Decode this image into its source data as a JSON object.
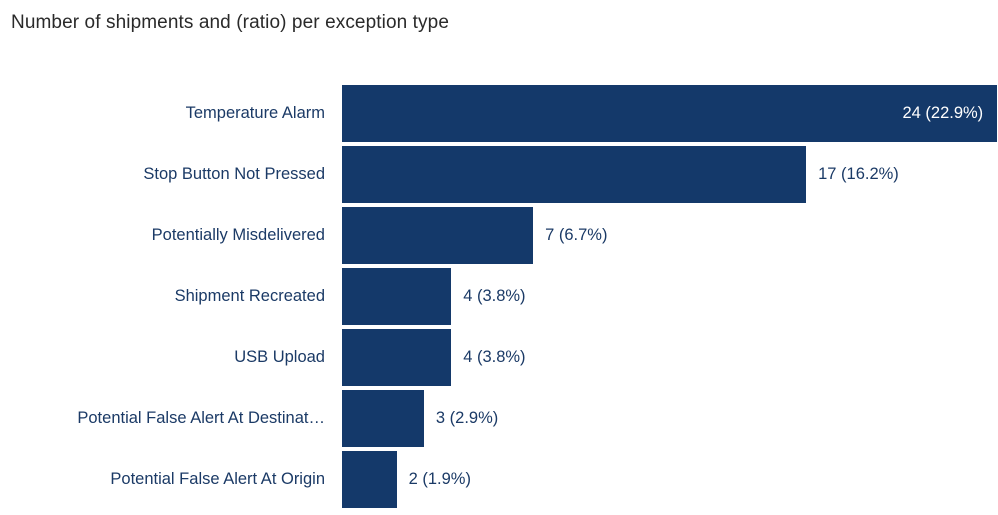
{
  "chart_data": {
    "type": "bar",
    "orientation": "horizontal",
    "title": "Number of shipments and (ratio) per exception type",
    "xlabel": "",
    "ylabel": "",
    "grid": false,
    "legend": null,
    "axis_ticks_visible": false,
    "categories": [
      "Temperature Alarm",
      "Stop Button Not Pressed",
      "Potentially Misdelivered",
      "Shipment Recreated",
      "USB Upload",
      "Potential False Alert At Destinat…",
      "Potential False Alert At Origin"
    ],
    "values": [
      24,
      17,
      7,
      4,
      4,
      3,
      2
    ],
    "ratios": [
      "22.9%",
      "16.2%",
      "6.7%",
      "3.8%",
      "3.8%",
      "2.9%",
      "1.9%"
    ],
    "point_labels": [
      "24  (22.9%)",
      "17  (16.2%)",
      "7  (6.7%)",
      "4  (3.8%)",
      "4  (3.8%)",
      "3  (2.9%)",
      "2  (1.9%)"
    ],
    "label_placement": [
      "inside",
      "outside",
      "outside",
      "outside",
      "outside",
      "outside",
      "outside"
    ],
    "xlim": [
      0,
      24
    ],
    "colors": {
      "bar": "#14396a",
      "title_text": "#2a2a2a",
      "category_text": "#1b3a66",
      "value_text_outside": "#1b3a66",
      "value_text_inside": "#ffffff",
      "background": "#ffffff"
    }
  }
}
